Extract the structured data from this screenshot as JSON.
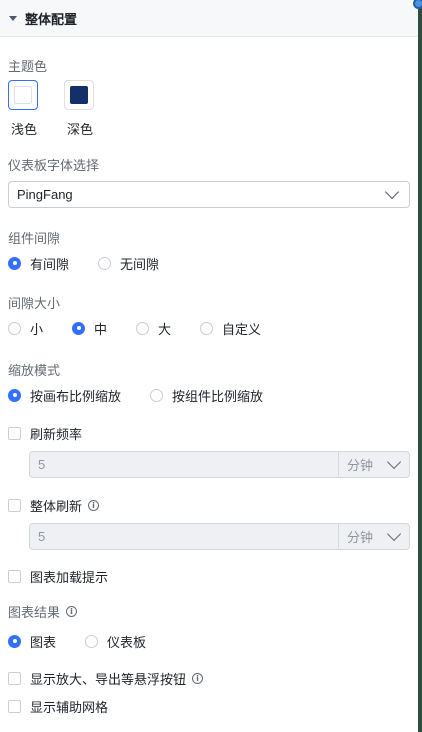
{
  "header": {
    "title": "整体配置"
  },
  "theme": {
    "label": "主题色",
    "options": [
      {
        "label": "浅色",
        "color": "#ffffff",
        "selected": true
      },
      {
        "label": "深色",
        "color": "#14306b",
        "selected": false
      }
    ]
  },
  "font": {
    "label": "仪表板字体选择",
    "value": "PingFang"
  },
  "spacing": {
    "label": "组件间隙",
    "options": [
      {
        "label": "有间隙",
        "checked": true
      },
      {
        "label": "无间隙",
        "checked": false
      }
    ]
  },
  "gap_size": {
    "label": "间隙大小",
    "options": [
      {
        "label": "小",
        "checked": false
      },
      {
        "label": "中",
        "checked": true
      },
      {
        "label": "大",
        "checked": false
      },
      {
        "label": "自定义",
        "checked": false
      }
    ]
  },
  "zoom": {
    "label": "缩放模式",
    "options": [
      {
        "label": "按画布比例缩放",
        "checked": true
      },
      {
        "label": "按组件比例缩放",
        "checked": false
      }
    ]
  },
  "refresh": {
    "label": "刷新频率",
    "checked": false,
    "value": "5",
    "unit": "分钟"
  },
  "global_refresh": {
    "label": "整体刷新",
    "checked": false,
    "value": "5",
    "unit": "分钟"
  },
  "loading_hint": {
    "label": "图表加载提示",
    "checked": false
  },
  "chart_result": {
    "label": "图表结果",
    "options": [
      {
        "label": "图表",
        "checked": true
      },
      {
        "label": "仪表板",
        "checked": false
      }
    ]
  },
  "float_buttons": {
    "label": "显示放大、导出等悬浮按钮",
    "checked": false
  },
  "grid": {
    "label": "显示辅助网格",
    "checked": false
  },
  "accent_color": "#3370ff"
}
